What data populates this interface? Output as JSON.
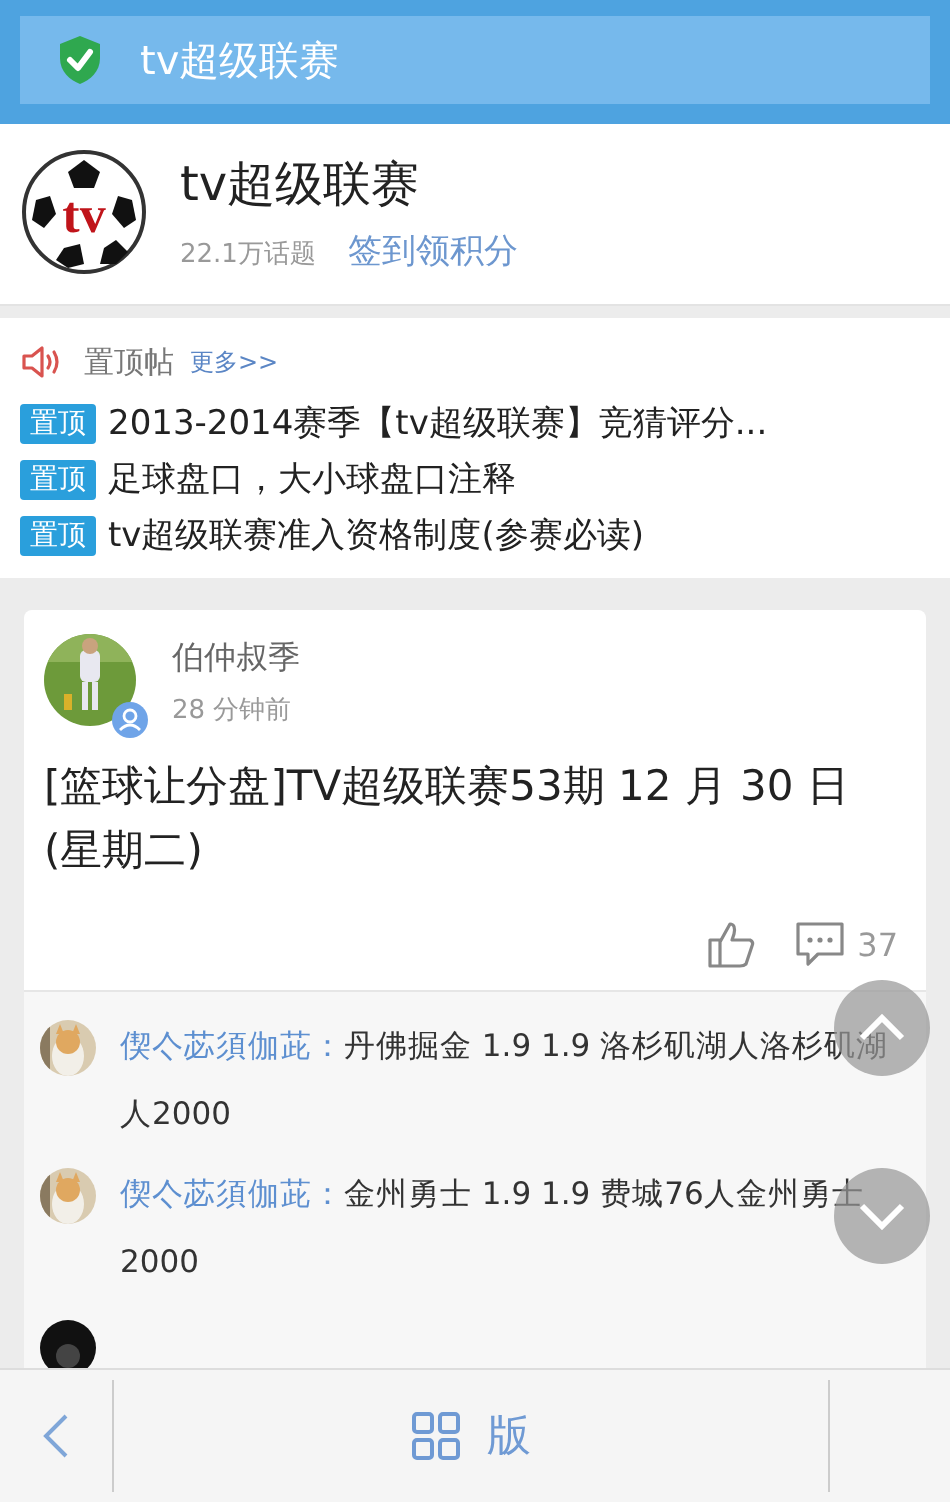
{
  "title_bar": {
    "title": "tv超级联赛",
    "verified": true
  },
  "forum": {
    "logo_text": "tv",
    "name": "tv超级联赛",
    "topics": "22.1万话题",
    "sign_in": "签到领积分"
  },
  "pinned": {
    "title": "置顶帖",
    "more": "更多>>",
    "items": [
      {
        "tag": "置顶",
        "title": "2013-2014赛季【tv超级联赛】竞猜评分..."
      },
      {
        "tag": "置顶",
        "title": "足球盘口，大小球盘口注释"
      },
      {
        "tag": "置顶",
        "title": "tv超级联赛准入资格制度(参赛必读)"
      }
    ]
  },
  "post": {
    "author": "伯仲叔季",
    "time": "28 分钟前",
    "title": "[篮球让分盘]TV超级联赛53期 12 月 30 日 (星期二)",
    "comments_count": "37",
    "comments": [
      {
        "author": "偰亽苾須伽茈：",
        "text": "丹佛掘金 1.9 1.9 洛杉矶湖人洛杉矶湖人2000"
      },
      {
        "author": "偰亽苾須伽茈：",
        "text": "金州勇士 1.9 1.9 费城76人金州勇士2000"
      }
    ]
  },
  "bottom_bar": {
    "label": "版"
  }
}
